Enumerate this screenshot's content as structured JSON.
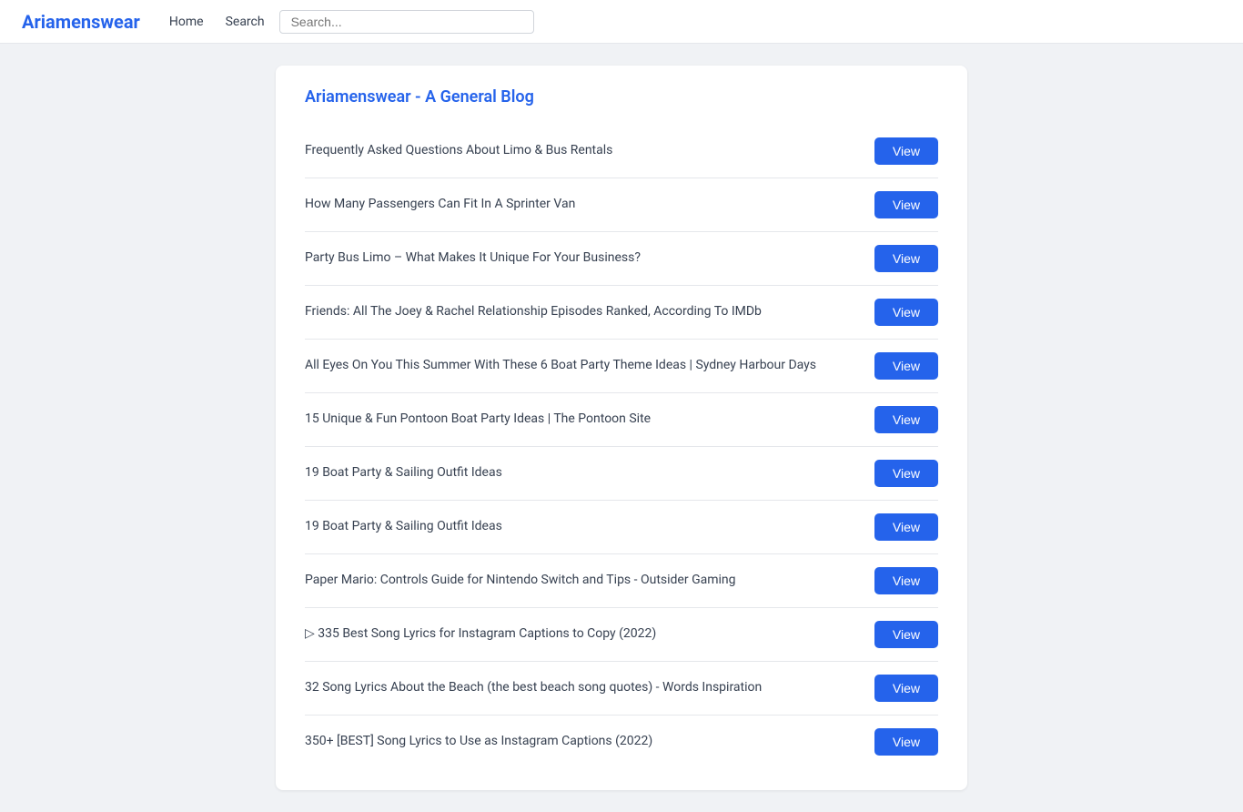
{
  "navbar": {
    "brand": "Ariamenswear",
    "links": [
      {
        "label": "Home"
      },
      {
        "label": "Search"
      }
    ],
    "search_placeholder": "Search..."
  },
  "blog": {
    "title": "Ariamenswear - A General Blog",
    "posts": [
      {
        "title": "Frequently Asked Questions About Limo & Bus Rentals",
        "btn": "View"
      },
      {
        "title": "How Many Passengers Can Fit In A Sprinter Van",
        "btn": "View"
      },
      {
        "title": "Party Bus Limo – What Makes It Unique For Your Business?",
        "btn": "View"
      },
      {
        "title": "Friends: All The Joey & Rachel Relationship Episodes Ranked, According To IMDb",
        "btn": "View"
      },
      {
        "title": "All Eyes On You This Summer With These 6 Boat Party Theme Ideas | Sydney Harbour Days",
        "btn": "View"
      },
      {
        "title": "15 Unique & Fun Pontoon Boat Party Ideas | The Pontoon Site",
        "btn": "View"
      },
      {
        "title": "19 Boat Party & Sailing Outfit Ideas",
        "btn": "View"
      },
      {
        "title": "19 Boat Party & Sailing Outfit Ideas",
        "btn": "View"
      },
      {
        "title": "Paper Mario: Controls Guide for Nintendo Switch and Tips - Outsider Gaming",
        "btn": "View"
      },
      {
        "title": "▷ 335 Best Song Lyrics for Instagram Captions to Copy (2022)",
        "btn": "View"
      },
      {
        "title": "32 Song Lyrics About the Beach (the best beach song quotes) - Words Inspiration",
        "btn": "View"
      },
      {
        "title": "350+ [BEST] Song Lyrics to Use as Instagram Captions (2022)",
        "btn": "View"
      }
    ]
  }
}
